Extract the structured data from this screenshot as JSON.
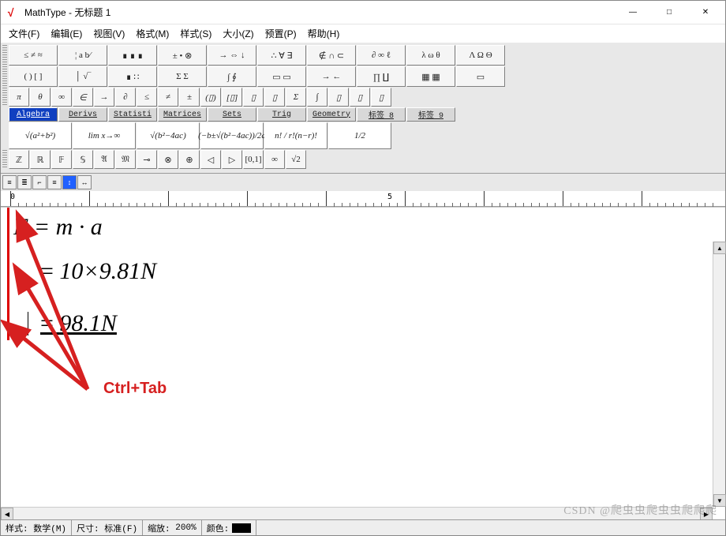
{
  "window": {
    "title": "MathType - 无标题 1",
    "min": "—",
    "max": "□",
    "close": "✕"
  },
  "menu": {
    "file": "文件(F)",
    "edit": "编辑(E)",
    "view": "视图(V)",
    "format": "格式(M)",
    "style": "样式(S)",
    "size": "大小(Z)",
    "pref": "预置(P)",
    "help": "帮助(H)"
  },
  "palette_row1": [
    "≤ ≠ ≈",
    "¦ a b⁄",
    "∎ ∎ ∎",
    "± • ⊗",
    "→ ⇔ ↓",
    "∴ ∀ ∃",
    "∉ ∩ ⊂",
    "∂ ∞ ℓ",
    "λ ω θ",
    "Λ Ω Θ"
  ],
  "palette_row2": [
    "( ) [ ]",
    "│ √‾",
    "∎ ∷",
    "Σ Σ",
    "∫ ∮",
    "▭ ▭",
    "→ ←",
    "∏ ∐",
    "▦ ▦",
    "▭"
  ],
  "symbol_row": [
    "π",
    "θ",
    "∞",
    "∈",
    "→",
    "∂",
    "≤",
    "≠",
    "±",
    "(▯)",
    "[▯]",
    "▯",
    "▯",
    "Σ",
    "∫",
    "▯",
    "▯",
    "▯"
  ],
  "tabs": [
    "Algebra",
    "Derivs",
    "Statisti",
    "Matrices",
    "Sets",
    "Trig",
    "Geometry",
    "标签 8",
    "标签 9"
  ],
  "active_tab": 0,
  "expr_row": [
    "√(a²+b²)",
    "lim x→∞",
    "√(b²−4ac)",
    "(−b±√(b²−4ac))/2a",
    "n! / r!(n−r)!",
    "1/2"
  ],
  "small_row": [
    "ℤ",
    "ℝ",
    "𝔽",
    "𝕊",
    "𝔄",
    "𝔐",
    "⊸",
    "⊗",
    "⊕",
    "◁",
    "▷",
    "[0,1]",
    "∞",
    "√2"
  ],
  "ruler": {
    "marks": [
      "0",
      "5"
    ]
  },
  "equation": {
    "line1": "F = m · a",
    "line2_pre": "=",
    "line2_val": "10×9.81N",
    "line3_pre": "=",
    "line3_val": "98.1N"
  },
  "annotation": {
    "label": "Ctrl+Tab"
  },
  "status": {
    "style_label": "样式:",
    "style_value": "数学(M)",
    "size_label": "尺寸:",
    "size_value": "标准(F)",
    "zoom_label": "缩放:",
    "zoom_value": "200%",
    "color_label": "颜色:"
  },
  "watermark": "CSDN @爬虫虫爬虫虫爬爬爬"
}
